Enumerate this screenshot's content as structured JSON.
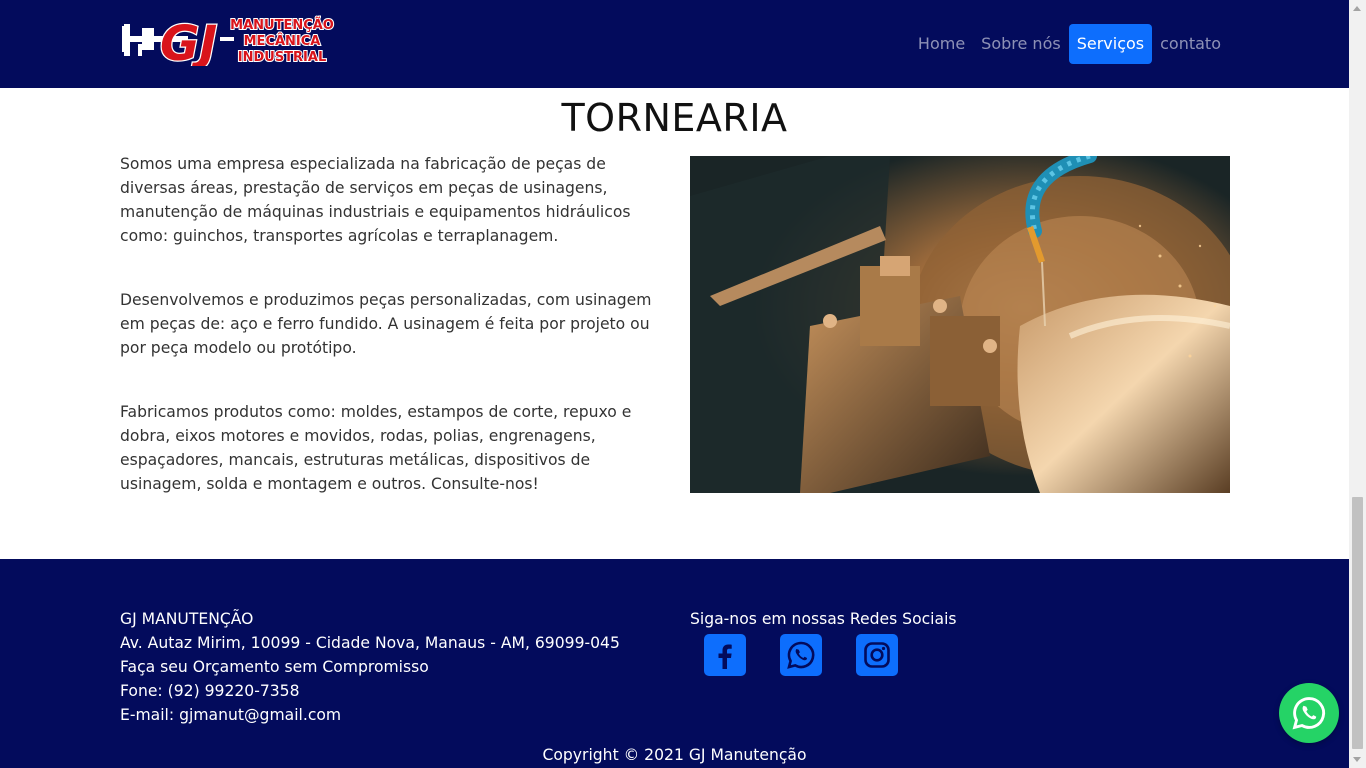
{
  "header": {
    "logo": {
      "initials": "GJ",
      "line1": "MANUTENÇÃO",
      "line2": "MECÂNICA",
      "line3": "INDUSTRIAL"
    },
    "nav": [
      {
        "label": "Home",
        "active": false
      },
      {
        "label": "Sobre nós",
        "active": false
      },
      {
        "label": "Serviços",
        "active": true
      },
      {
        "label": "contato",
        "active": false
      }
    ]
  },
  "main": {
    "title": "TORNEARIA",
    "paragraphs": [
      "Somos uma empresa especializada na fabricação de peças de diversas áreas, prestação de serviços em peças de usinagens, manutenção de máquinas industriais e equipamentos hidráulicos como: guinchos, transportes agrícolas e terraplanagem.",
      "Desenvolvemos e produzimos peças personalizadas, com usinagem em peças de: aço e ferro fundido. A usinagem é feita por projeto ou por peça modelo ou protótipo.",
      "Fabricamos produtos como: moldes, estampos de corte, repuxo e dobra, eixos motores e movidos, rodas, polias, engrenagens, espaçadores, mancais, estruturas metálicas, dispositivos de usinagem, solda e montagem e outros. Consulte-nos!"
    ],
    "image_icon": "lathe-machine-photo"
  },
  "footer": {
    "company": "GJ MANUTENÇÃO",
    "address": "Av. Autaz Mirim, 10099 - Cidade Nova, Manaus - AM, 69099-045",
    "tagline": "Faça seu Orçamento sem Compromisso",
    "phone": "Fone: (92) 99220-7358",
    "email": "E-mail: gjmanut@gmail.com",
    "social_heading": "Siga-nos em nossas Redes Sociais",
    "social_icons": [
      "facebook-icon",
      "whatsapp-icon",
      "instagram-icon"
    ],
    "copyright": "Copyright © 2021 GJ Manutenção"
  },
  "floating": {
    "icon": "whatsapp-icon"
  },
  "colors": {
    "navy": "#030b5c",
    "accent": "#0d6efd",
    "logo_red": "#d9141b",
    "whatsapp": "#25d366"
  }
}
